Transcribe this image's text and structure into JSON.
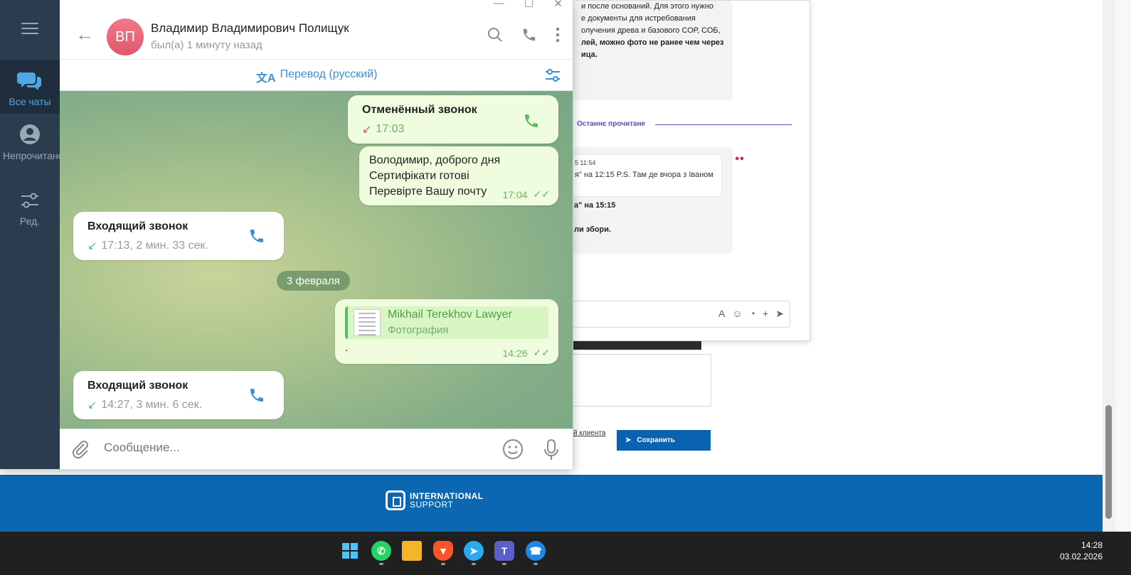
{
  "background_page": {
    "card1_lines": [
      "и после оснований. Для этого нужно",
      "е документы для истребования",
      "олучения древа и базового СОР, СОБ,",
      "лей, можно фото не ранее чем через",
      "ица."
    ],
    "divider_label": "Останнє прочитане",
    "quote_time": "5 11:54",
    "quote_text": "я\" на 12:15 P.S. Там де вчора з Іваном",
    "card2_bold1": "а\" на 15:15",
    "card2_bold2": "ли збори.",
    "client_link": "й клиента",
    "save_button": "Сохранить",
    "footer_logo_line1": "INTERNATIONAL",
    "footer_logo_line2": "SUPPORT"
  },
  "sidebar": {
    "items": [
      {
        "label": "Все чаты",
        "icon": "chats-icon"
      },
      {
        "label": "Непрочитано",
        "icon": "person-icon"
      },
      {
        "label": "Ред.",
        "icon": "sliders-icon"
      }
    ]
  },
  "header": {
    "avatar_initials": "ВП",
    "contact_name": "Владимир Владимирович Полищук",
    "contact_status": "был(а) 1 минуту назад"
  },
  "translate_bar": {
    "label": "Перевод (русский)"
  },
  "messages": {
    "m1_title": "Отменённый звонок",
    "m1_time": "17:03",
    "m2_line1": "Володимир, доброго дня",
    "m2_line2": "Сертифікати готові",
    "m2_line3": "Перевірте Вашу почту",
    "m2_time": "17:04",
    "m3_title": "Входящий звонок",
    "m3_meta": "17:13, 2 мин. 33 сек.",
    "date_separator": "3 февраля",
    "m4_sender": "Mikhail Terekhov Lawyer",
    "m4_type": "Фотография",
    "m4_text": ".",
    "m4_time": "14:26",
    "m5_title": "Входящий звонок",
    "m5_meta": "14:27, 3 мин. 6 сек."
  },
  "input": {
    "placeholder": "Сообщение..."
  },
  "taskbar": {
    "time": "14:28",
    "date": "03.02.2026"
  },
  "colors": {
    "accent": "#3a8fd4",
    "sidebar_bg": "#2b3c4f",
    "outgoing_bubble": "#effdde",
    "missed_call": "#e05a4a",
    "check_green": "#6fb16a"
  }
}
